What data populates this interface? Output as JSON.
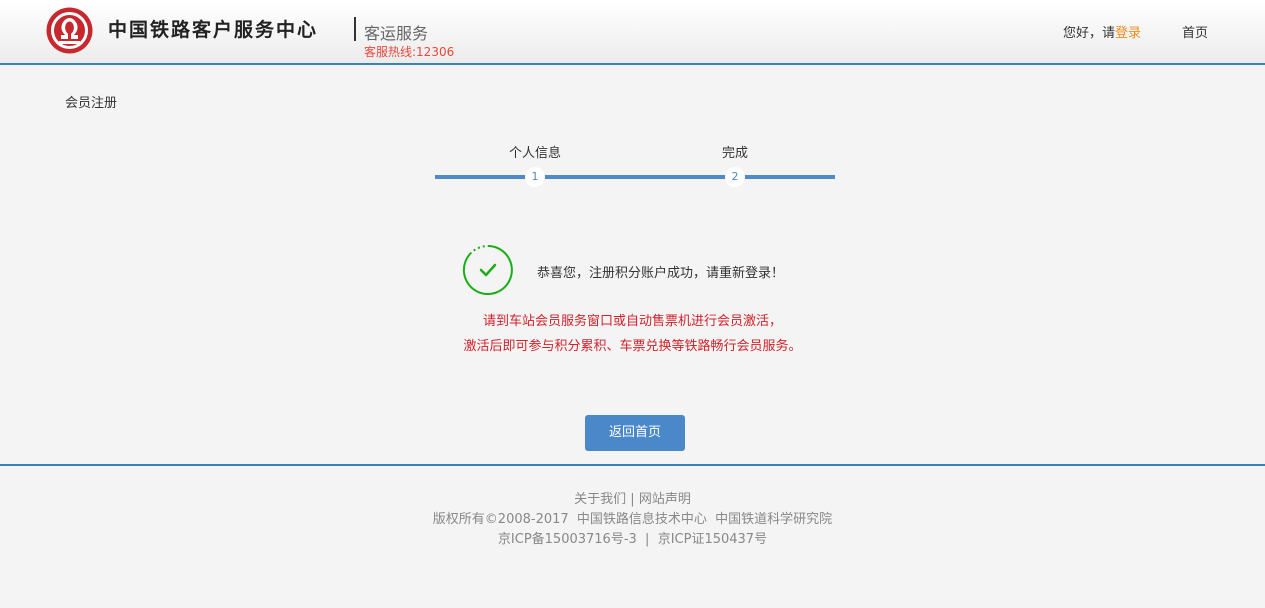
{
  "header": {
    "brand": "中国铁路客户服务中心",
    "subtitle": "客运服务",
    "hotline": "客服热线:12306",
    "greeting_prefix": "您好，请",
    "login_link": "登录",
    "home_link": "首页",
    "logo_icon": "railway-logo-icon",
    "brand_color": "#c6282e"
  },
  "main": {
    "page_title": "会员注册",
    "steps": [
      {
        "label": "个人信息",
        "number": "1"
      },
      {
        "label": "完成",
        "number": "2"
      }
    ],
    "success_icon": "check-circle-icon",
    "success_message": "恭喜您，注册积分账户成功，请重新登录！",
    "note_line1": "请到车站会员服务窗口或自动售票机进行会员激活，",
    "note_line2": "激活后即可参与积分累积、车票兑换等铁路畅行会员服务。",
    "back_button": "返回首页"
  },
  "footer": {
    "about": "关于我们",
    "sep": "|",
    "statement": "网站声明",
    "copyright": "版权所有©2008-2017  中国铁路信息技术中心  中国铁道科学研究院",
    "icp": "京ICP备15003716号-3  |  京ICP证150437号"
  },
  "colors": {
    "accent_blue": "#4a88c9",
    "success_green": "#1aad19",
    "note_red": "#d3222a",
    "login_orange": "#f08b1d",
    "hotline_red": "#e8483b"
  }
}
